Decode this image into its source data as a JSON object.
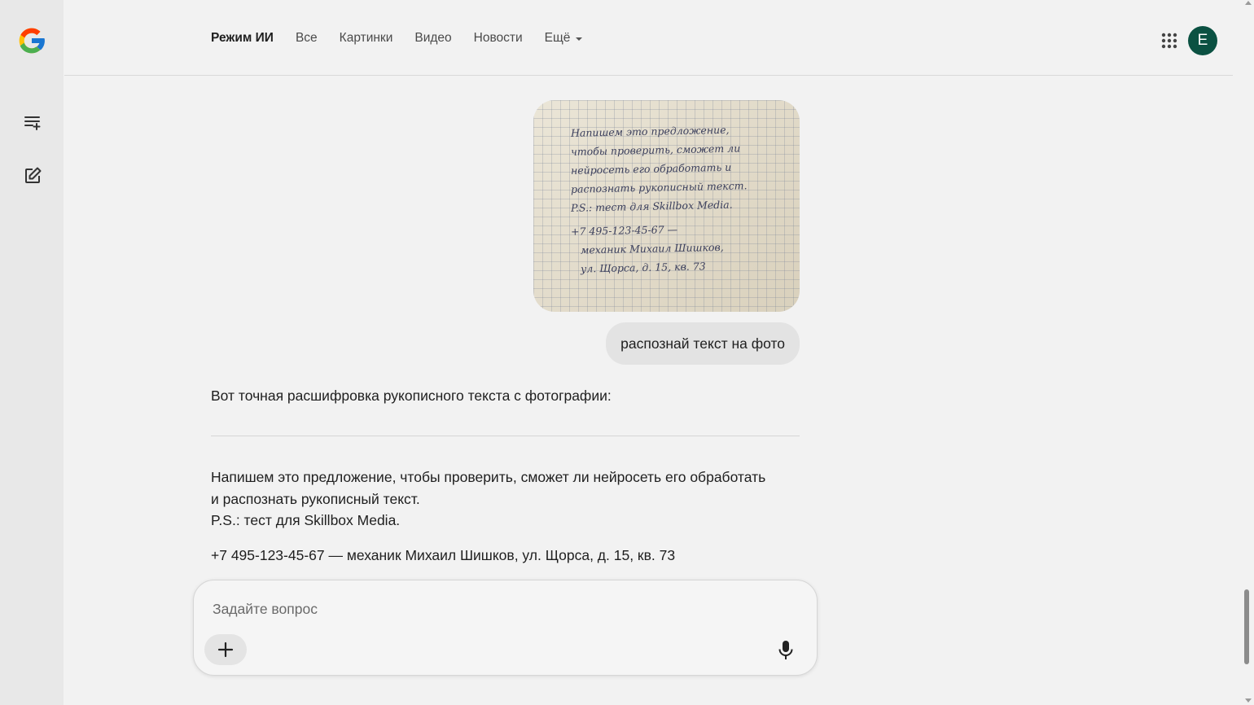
{
  "header": {
    "tabs": [
      {
        "label": "Режим ИИ",
        "active": true
      },
      {
        "label": "Все"
      },
      {
        "label": "Картинки"
      },
      {
        "label": "Видео"
      },
      {
        "label": "Новости"
      }
    ],
    "more_label": "Ещё",
    "avatar_letter": "E",
    "avatar_color": "#0b5142"
  },
  "sidebar": {
    "icons": [
      "google-logo",
      "history-icon",
      "new-chat-icon"
    ]
  },
  "chat": {
    "image_text": [
      "Напишем это предложение,",
      "чтобы проверить, сможет ли",
      "нейросеть его обработать и",
      "распознать рукописный текст.",
      "P.S.: тест для Skillbox Media.",
      "+7 495-123-45-67 —",
      "механик Михаил Шишков,",
      "ул. Щорса, д. 15, кв. 73"
    ],
    "user_message": "распознай текст на фото",
    "response": {
      "intro": "Вот точная расшифровка рукописного текста с фотографии:",
      "transcript": [
        "Напишем это предложение, чтобы проверить, сможет ли нейросеть его обработать",
        "и распознать рукописный текст.",
        "P.S.: тест для Skillbox Media."
      ],
      "contact": "+7 495-123-45-67 — механик Михаил Шишков, ул. Щорса, д. 15, кв. 73"
    }
  },
  "input": {
    "placeholder": "Задайте вопрос",
    "value": ""
  },
  "colors": {
    "background": "#f2f2f2",
    "rail": "#e8e8e8",
    "bubble": "#e3e3e3",
    "accent": "#0b5142"
  }
}
